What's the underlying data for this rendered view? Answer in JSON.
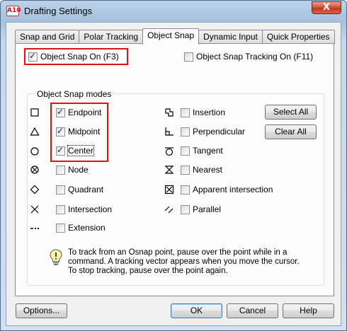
{
  "window": {
    "title": "Drafting Settings",
    "app_icon_text": "A10",
    "close_glyph": "X"
  },
  "tabs": [
    {
      "label": "Snap and Grid"
    },
    {
      "label": "Polar Tracking"
    },
    {
      "label": "Object Snap"
    },
    {
      "label": "Dynamic Input"
    },
    {
      "label": "Quick Properties"
    }
  ],
  "object_snap_on": {
    "label": "Object Snap On (F3)",
    "checked": true
  },
  "object_snap_tracking_on": {
    "label": "Object Snap Tracking On (F11)",
    "checked": false
  },
  "modes": {
    "group_label": "Object Snap modes",
    "left": [
      {
        "label": "Endpoint",
        "checked": true,
        "icon": "endpoint-square-icon"
      },
      {
        "label": "Midpoint",
        "checked": true,
        "icon": "midpoint-triangle-icon"
      },
      {
        "label": "Center",
        "checked": true,
        "icon": "center-circle-icon"
      },
      {
        "label": "Node",
        "checked": false,
        "icon": "node-icon"
      },
      {
        "label": "Quadrant",
        "checked": false,
        "icon": "quadrant-diamond-icon"
      },
      {
        "label": "Intersection",
        "checked": false,
        "icon": "intersection-x-icon"
      },
      {
        "label": "Extension",
        "checked": false,
        "icon": "extension-dash-icon"
      }
    ],
    "right": [
      {
        "label": "Insertion",
        "checked": false,
        "icon": "insertion-icon"
      },
      {
        "label": "Perpendicular",
        "checked": false,
        "icon": "perpendicular-icon"
      },
      {
        "label": "Tangent",
        "checked": false,
        "icon": "tangent-icon"
      },
      {
        "label": "Nearest",
        "checked": false,
        "icon": "nearest-hourglass-icon"
      },
      {
        "label": "Apparent intersection",
        "checked": false,
        "icon": "apparent-intersection-icon"
      },
      {
        "label": "Parallel",
        "checked": false,
        "icon": "parallel-icon"
      }
    ],
    "select_all_label": "Select All",
    "clear_all_label": "Clear All"
  },
  "info": {
    "icon": "lightbulb-icon",
    "line1": "To track from an Osnap point, pause over the point while in a",
    "line2": "command.  A tracking vector appears when you move the cursor.",
    "line3": "To stop tracking, pause over the point again."
  },
  "footer": {
    "options_label": "Options...",
    "ok_label": "OK",
    "cancel_label": "Cancel",
    "help_label": "Help"
  },
  "colors": {
    "highlight": "#e0101a",
    "default_button_border": "#3c7fb1"
  }
}
